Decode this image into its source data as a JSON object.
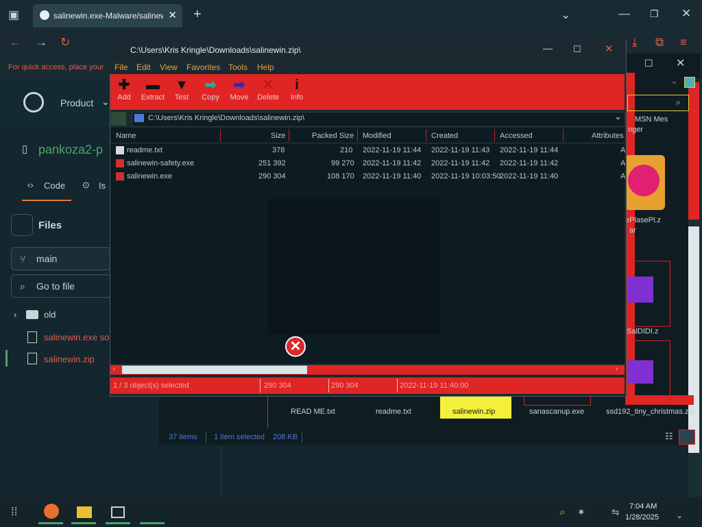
{
  "browser": {
    "tab_title": "salinewin.exe-Malware/salinew",
    "new_tab": "+",
    "bookmark_hint": "For quick access, place your"
  },
  "github": {
    "nav_product": "Product",
    "repo_name": "pankoza2-p",
    "tab_code": "Code",
    "tab_issues": "Is",
    "files_heading": "Files",
    "branch": "main",
    "goto_file": "Go to file",
    "tree": [
      {
        "name": "old"
      },
      {
        "name": "salinewin.exe so"
      },
      {
        "name": "salinewin.zip"
      }
    ]
  },
  "explorer": {
    "right_labels": [
      "MSN Mes",
      "nger"
    ],
    "partial_label_1": "ePlasePl.z",
    "partial_label_2": "ar",
    "partial_label_3": "SalDIDI.z",
    "bottom_icons": [
      {
        "label": "READ ME.txt"
      },
      {
        "label": "readme.txt"
      },
      {
        "label": "salinewin.zip"
      },
      {
        "label": "sanascanup.exe"
      },
      {
        "label": "ssd192_tiny_christmas.zip"
      }
    ],
    "status_items": "37 items",
    "status_selected": "1 item selected",
    "status_size": "208 KB"
  },
  "zip": {
    "title": "C:\\Users\\Kris Kringle\\Downloads\\salinewin.zip\\",
    "menu": [
      "File",
      "Edit",
      "View",
      "Favorites",
      "Tools",
      "Help"
    ],
    "toolbar": [
      {
        "label": "Add",
        "icon": "plus-icon"
      },
      {
        "label": "Extract",
        "icon": "minus-icon"
      },
      {
        "label": "Test",
        "icon": "check-icon"
      },
      {
        "label": "Copy",
        "icon": "copy-arrow-icon"
      },
      {
        "label": "Move",
        "icon": "move-arrow-icon"
      },
      {
        "label": "Delete",
        "icon": "delete-x-icon"
      },
      {
        "label": "Info",
        "icon": "info-icon"
      }
    ],
    "address": "C:\\Users\\Kris Kringle\\Downloads\\salinewin.zip\\",
    "columns": [
      "Name",
      "Size",
      "Packed Size",
      "Modified",
      "Created",
      "Accessed",
      "Attributes"
    ],
    "rows": [
      {
        "name": "readme.txt",
        "size": "378",
        "packed": "210",
        "modified": "2022-11-19 11:44",
        "created": "2022-11-19 11:43",
        "accessed": "2022-11-19 11:44",
        "attr": "A"
      },
      {
        "name": "salinewin-safety.exe",
        "size": "251 392",
        "packed": "99 270",
        "modified": "2022-11-19 11:42",
        "created": "2022-11-19 11:42",
        "accessed": "2022-11-19 11:42",
        "attr": "A"
      },
      {
        "name": "salinewin.exe",
        "size": "290 304",
        "packed": "108 170",
        "modified": "2022-11-19 11:40",
        "created": "2022-11-19 10:03:50",
        "accessed": "2022-11-19 11:40",
        "attr": "A"
      }
    ],
    "status": {
      "selected": "1 / 3 object(s) selected",
      "size": "290 304",
      "packed": "290 304",
      "modified": "2022-11-19 11:40:00"
    }
  },
  "taskbar": {
    "time": "7:04 AM",
    "date": "1/28/2025"
  }
}
